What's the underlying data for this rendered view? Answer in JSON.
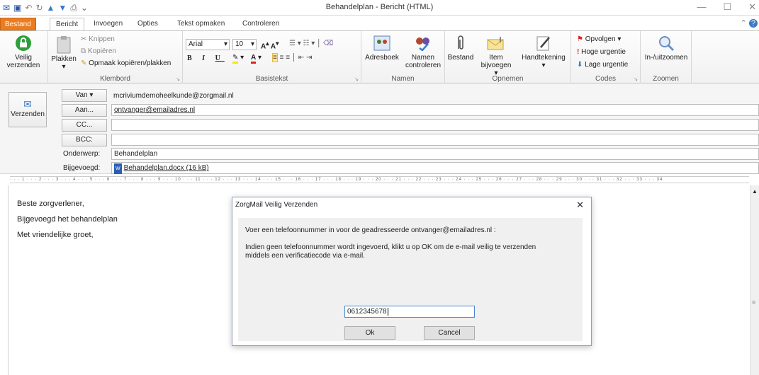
{
  "window": {
    "title": "Behandelplan - Bericht (HTML)"
  },
  "tabs": [
    "Bestand",
    "Bericht",
    "Invoegen",
    "Opties",
    "Tekst opmaken",
    "Controleren"
  ],
  "ribbon": {
    "secure_send": "Veilig verzenden",
    "paste": "Plakken",
    "cut": "Knippen",
    "copy": "Kopiëren",
    "format_painter": "Opmaak kopiëren/plakken",
    "clipboard_group": "Klembord",
    "font_name": "Arial",
    "font_size": "10",
    "basic_text_group": "Basistekst",
    "address_book": "Adresboek",
    "check_names": "Namen controleren",
    "names_group": "Namen",
    "attach_file": "Bestand",
    "attach_item": "Item bijvoegen",
    "signature": "Handtekening",
    "include_group": "Opnemen",
    "follow_up": "Opvolgen",
    "high_importance": "Hoge urgentie",
    "low_importance": "Lage urgentie",
    "tags_group": "Codes",
    "zoom": "In-/uitzoomen",
    "zoom_group": "Zoomen"
  },
  "header": {
    "send_button": "Verzenden",
    "from_button": "Van",
    "from_value": "mcriviumdemoheelkunde@zorgmail.nl",
    "to_button": "Aan...",
    "to_value": "ontvanger@emailadres.nl",
    "cc_button": "CC...",
    "bcc_button": "BCC:",
    "subject_label": "Onderwerp:",
    "subject_value": "Behandelplan",
    "attached_label": "Bijgevoegd:",
    "attachment": "Behandelplan.docx (16 kB)"
  },
  "body": {
    "line1": "Beste zorgverlener,",
    "line2": "Bijgevoegd het behandelplan",
    "line3": "Met vriendelijke groet,"
  },
  "dialog": {
    "title": "ZorgMail Veilig Verzenden",
    "prompt": "Voer een telefoonnummer in voor de geadresseerde ontvanger@emailadres.nl :",
    "info": "Indien geen telefoonnummer wordt ingevoerd, klikt u op OK om de e-mail veilig te verzenden middels een verificatiecode via e-mail.",
    "phone_value": "0612345678",
    "ok": "Ok",
    "cancel": "Cancel"
  },
  "colors": {
    "file_tab": "#e97d22",
    "secure_icon": "#2e9e3a"
  }
}
